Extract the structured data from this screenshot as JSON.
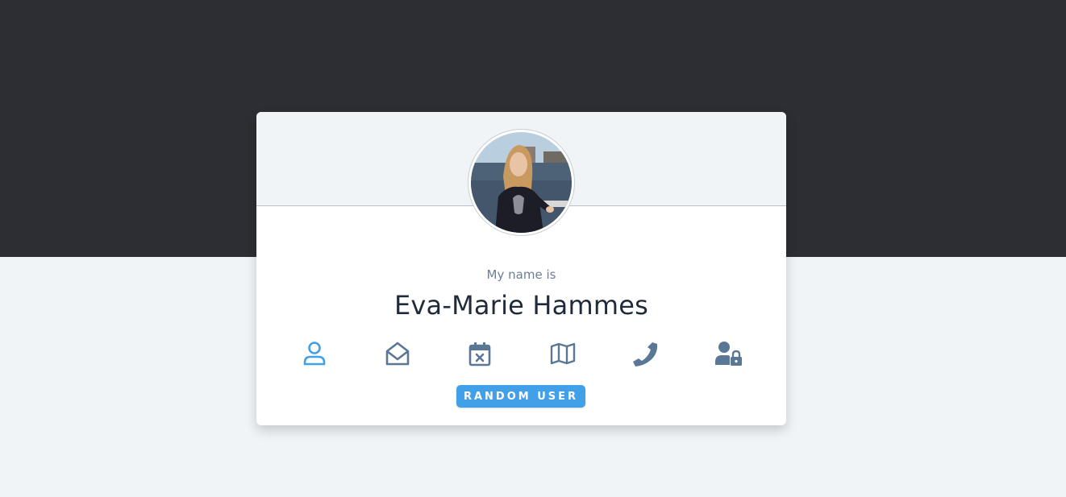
{
  "profile": {
    "label": "My name is",
    "value": "Eva-Marie Hammes",
    "avatar_icon": "user-photo"
  },
  "icons": [
    {
      "name": "user-icon",
      "active": true
    },
    {
      "name": "envelope-open-icon",
      "active": false
    },
    {
      "name": "calendar-x-icon",
      "active": false
    },
    {
      "name": "map-icon",
      "active": false
    },
    {
      "name": "phone-icon",
      "active": false
    },
    {
      "name": "user-lock-icon",
      "active": false
    }
  ],
  "button": {
    "label": "RANDOM USER"
  },
  "colors": {
    "dark_band": "#2c2e33",
    "page_bg": "#f0f4f7",
    "accent": "#42a0e8",
    "icon_default": "#5a7896",
    "name_text": "#1f2b3a",
    "label_text": "#6a7f96"
  }
}
